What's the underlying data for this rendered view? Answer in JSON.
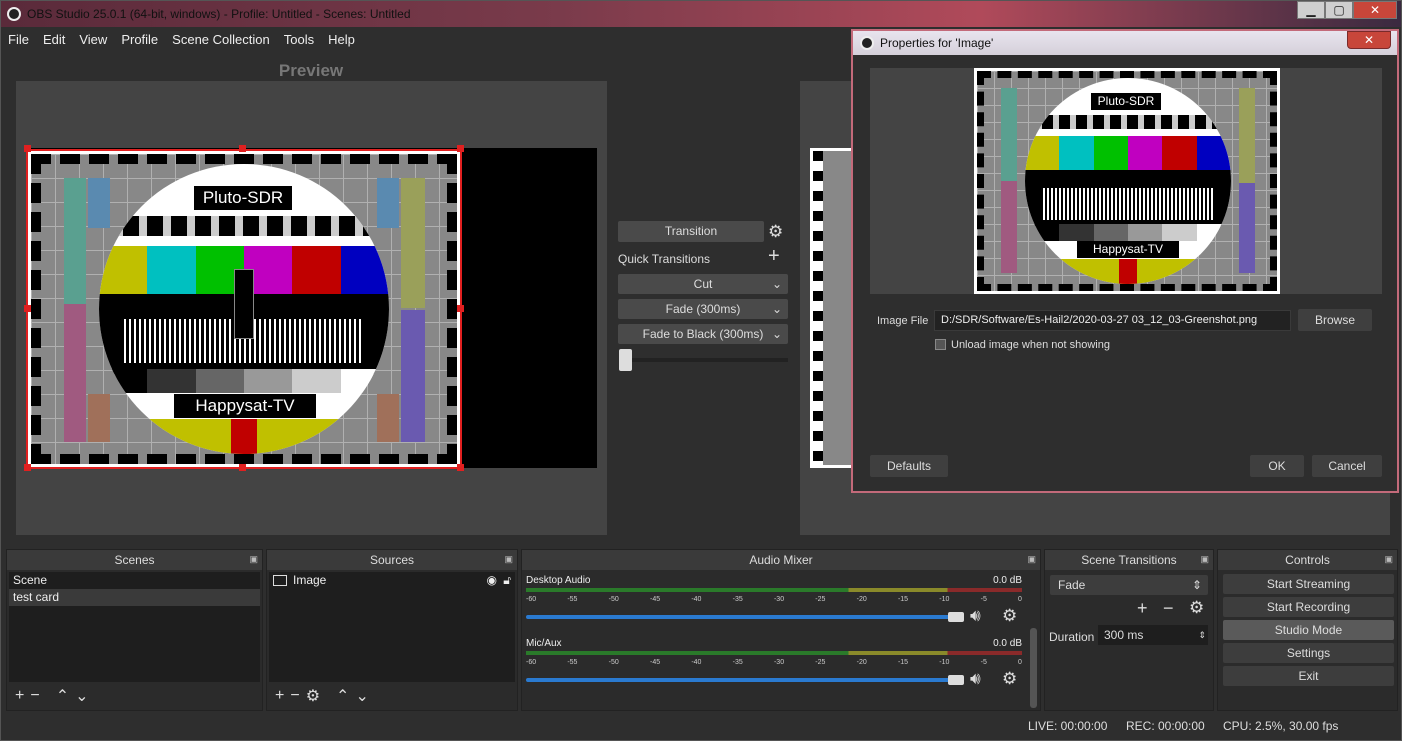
{
  "window": {
    "title": "OBS Studio 25.0.1 (64-bit, windows) - Profile: Untitled - Scenes: Untitled",
    "min_label": "▁",
    "max_label": "▢",
    "close_label": "✕"
  },
  "menu": [
    "File",
    "Edit",
    "View",
    "Profile",
    "Scene Collection",
    "Tools",
    "Help"
  ],
  "preview_label": "Preview",
  "testcard": {
    "top_label": "Pluto-SDR",
    "bottom_label": "Happysat-TV",
    "bar_colors": [
      "#c0c000",
      "#00c0c0",
      "#00c000",
      "#c000c0",
      "#c00000",
      "#0000c0"
    ]
  },
  "transition_panel": {
    "transition_label": "Transition",
    "quick_transitions_label": "Quick Transitions",
    "items": [
      "Cut",
      "Fade (300ms)",
      "Fade to Black (300ms)"
    ]
  },
  "docks": {
    "scenes": {
      "title": "Scenes",
      "items": [
        "Scene",
        "test card"
      ]
    },
    "sources": {
      "title": "Sources",
      "items": [
        "Image"
      ]
    },
    "audio_mixer": {
      "title": "Audio Mixer",
      "channels": [
        {
          "name": "Desktop Audio",
          "level": "0.0 dB"
        },
        {
          "name": "Mic/Aux",
          "level": "0.0 dB"
        }
      ],
      "scale": [
        "-60",
        "-55",
        "-50",
        "-45",
        "-40",
        "-35",
        "-30",
        "-25",
        "-20",
        "-15",
        "-10",
        "-5",
        "0"
      ]
    },
    "scene_transitions": {
      "title": "Scene Transitions",
      "selected": "Fade",
      "duration_label": "Duration",
      "duration_value": "300 ms"
    },
    "controls": {
      "title": "Controls",
      "buttons": [
        "Start Streaming",
        "Start Recording",
        "Studio Mode",
        "Settings",
        "Exit"
      ]
    }
  },
  "status": {
    "live": "LIVE: 00:00:00",
    "rec": "REC: 00:00:00",
    "cpu": "CPU: 2.5%, 30.00 fps"
  },
  "dialog": {
    "title": "Properties for 'Image'",
    "image_file_label": "Image File",
    "image_file_value": "D:/SDR/Software/Es-Hail2/2020-03-27 03_12_03-Greenshot.png",
    "browse_label": "Browse",
    "unload_label": "Unload image when not showing",
    "defaults_label": "Defaults",
    "ok_label": "OK",
    "cancel_label": "Cancel"
  },
  "icons": {
    "gear": "gear-icon",
    "plus": "plus-icon",
    "minus": "minus-icon",
    "up": "arrow-up-icon",
    "down": "arrow-down-icon",
    "eye": "eye-icon",
    "lock": "lock-icon",
    "speaker": "speaker-icon",
    "chevron": "chevron-down-icon"
  }
}
